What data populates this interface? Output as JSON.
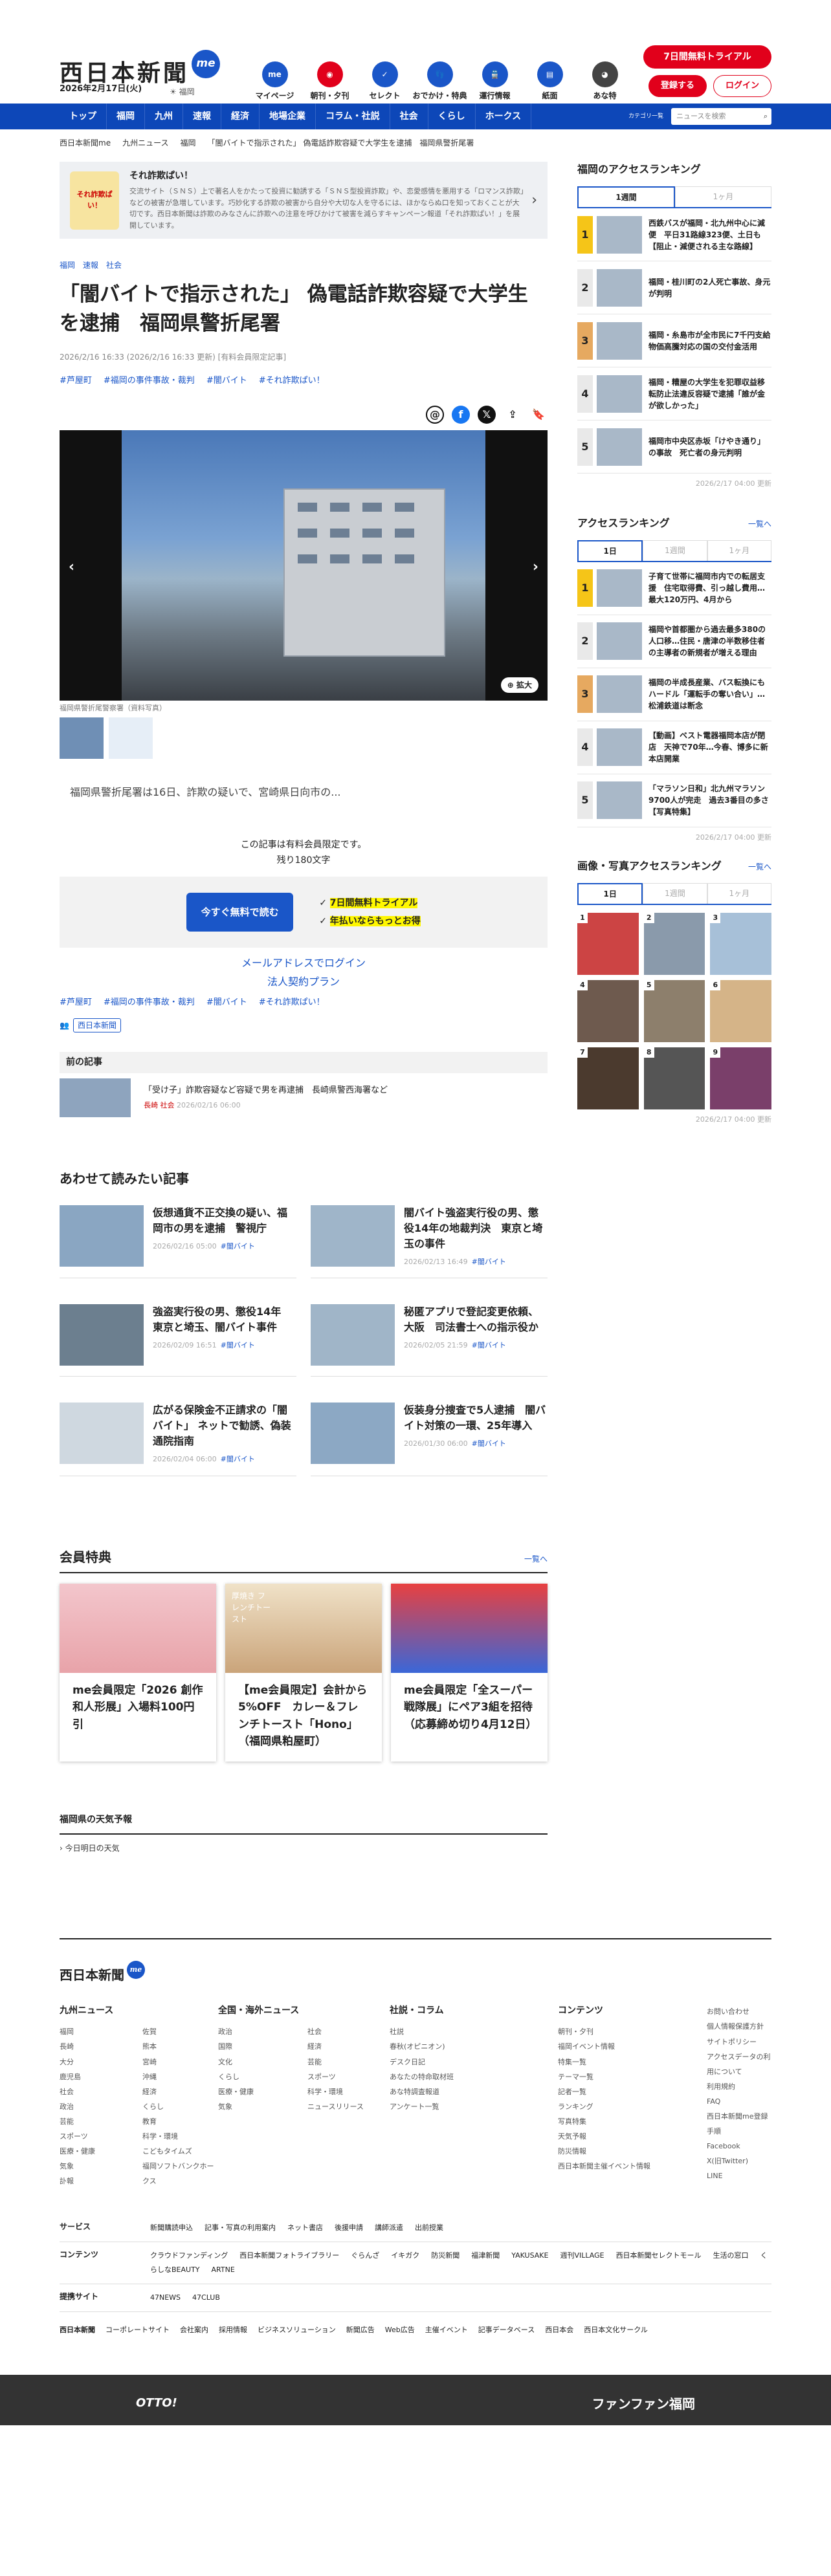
{
  "header": {
    "logo": "西日本新聞",
    "me": "me",
    "date": "2026年2月17日(火)",
    "weather": "福岡",
    "icons": [
      {
        "label": "マイページ",
        "icon": "me-icon",
        "color": "#1a56c8",
        "glyph": "me"
      },
      {
        "label": "朝刊・夕刊",
        "icon": "newspaper-icon",
        "color": "#e1001b",
        "glyph": "◉"
      },
      {
        "label": "セレクト",
        "icon": "select-icon",
        "color": "#1a56c8",
        "glyph": "✓"
      },
      {
        "label": "おでかけ・特典",
        "icon": "footsteps-icon",
        "color": "#1a56c8",
        "glyph": "👣"
      },
      {
        "label": "運行情報",
        "icon": "train-icon",
        "color": "#1a56c8",
        "glyph": "🚆"
      },
      {
        "label": "紙面",
        "icon": "paper-icon",
        "color": "#1a56c8",
        "glyph": "▤"
      },
      {
        "label": "あな特",
        "icon": "raccoon-icon",
        "color": "#444",
        "glyph": "◕"
      }
    ],
    "trial": "7日間無料トライアル",
    "register": "登録する",
    "login": "ログイン"
  },
  "nav": {
    "items": [
      "トップ",
      "福岡",
      "九州",
      "速報",
      "経済",
      "地場企業",
      "コラム・社説",
      "社会",
      "くらし",
      "ホークス"
    ],
    "category": "カテゴリ一覧",
    "search_placeholder": "ニュースを検索"
  },
  "breadcrumb": [
    "西日本新聞me",
    "九州ニュース",
    "福岡",
    "「闇バイトで指示された」 偽電話詐欺容疑で大学生を逮捕　福岡県警折尾署"
  ],
  "promo": {
    "img": "それ詐欺ぱい！",
    "title": "それ詐欺ぱい！",
    "text": "交流サイト（ＳＮＳ）上で著名人をかたって投資に勧誘する「ＳＮＳ型投資詐欺」や、恋愛感情を悪用する「ロマンス詐欺」などの被害が急増しています。巧妙化する詐欺の被害から自分や大切な人を守るには、ほかならぬ口を知っておくことが大切です。西日本新聞は詐欺のみなさんに詐欺への注意を呼びかけて被害を減らすキャンペーン報道「それ詐欺ぱい！」を展開しています。"
  },
  "article": {
    "categories": [
      "福岡",
      "速報",
      "社会"
    ],
    "title": "「闇バイトで指示された」 偽電話詐欺容疑で大学生を逮捕　福岡県警折尾署",
    "dates": "2026/2/16 16:33 (2026/2/16 16:33 更新) [有料会員限定記事]",
    "tags": [
      "#芦屋町",
      "#福岡の事件事故・裁判",
      "#闇バイト",
      "#それ詐欺ぱい！"
    ],
    "caption": "福岡県警折尾警察署（資料写真）",
    "zoom": "拡大",
    "lead": "福岡県警折尾署は16日、詐欺の疑いで、宮崎県日向市の...",
    "paywall_1": "この記事は有料会員限定です。",
    "paywall_2": "残り180文字",
    "cta": "今すぐ無料で読む",
    "benefits": [
      "7日間無料トライアル",
      "年払いならもっとお得"
    ],
    "login_mail": "メールアドレスでログイン",
    "corp": "法人契約プラン",
    "author": "西日本新聞"
  },
  "prev": {
    "heading": "前の記事",
    "title": "「受け子」詐欺容疑など容疑で男を再逮捕　長崎県警西海署など",
    "meta": "長崎 社会",
    "date": "2026/02/16 06:00"
  },
  "related": {
    "heading": "あわせて読みたい記事",
    "items": [
      {
        "title": "仮想通貨不正交換の疑い、福岡市の男を逮捕　警視庁",
        "date": "2026/02/16 05:00",
        "tag": "#闇バイト"
      },
      {
        "title": "闇バイト強盗実行役の男、懲役14年の地裁判決　東京と埼玉の事件",
        "date": "2026/02/13 16:49",
        "tag": "#闇バイト"
      },
      {
        "title": "強盗実行役の男、懲役14年　東京と埼玉、闇バイト事件",
        "date": "2026/02/09 16:51",
        "tag": "#闇バイト"
      },
      {
        "title": "秘匿アプリで登記変更依頼、大阪　司法書士への指示役か",
        "date": "2026/02/05 21:59",
        "tag": "#闇バイト"
      },
      {
        "title": "広がる保険金不正請求の「闇バイト」 ネットで勧誘、偽装通院指南",
        "date": "2026/02/04 06:00",
        "tag": "#闇バイト"
      },
      {
        "title": "仮装身分捜査で5人逮捕　闇バイト対策の一環、25年導入",
        "date": "2026/01/30 06:00",
        "tag": "#闇バイト"
      }
    ]
  },
  "member": {
    "heading": "会員特典",
    "more": "一覧へ",
    "cards": [
      {
        "title": "me会員限定「2026 創作和人形展」入場料100円引"
      },
      {
        "title": "【me会員限定】会計から5%OFF　カレー＆フレンチトースト「Hono」（福岡県粕屋町）",
        "img": "厚焼き フレンチトースト"
      },
      {
        "title": "me会員限定「全スーパー戦隊展」にペア3組を招待（応募締め切り4月12日）"
      }
    ]
  },
  "weather": {
    "heading": "福岡県の天気予報",
    "item": "今日明日の天気"
  },
  "sidebar": {
    "rank1": {
      "heading": "福岡のアクセスランキング",
      "tabs": [
        "1週間",
        "1ヶ月"
      ],
      "items": [
        "西鉄バスが福岡・北九州中心に減便　平日31路線323便、土日も【阻止・減便される主な路線】",
        "福岡・桂川町の2人死亡事故、身元が判明",
        "福岡・糸島市が全市民に7千円支給　物価高騰対応の国の交付金活用",
        "福岡・糟屋の大学生を犯罪収益移転防止法違反容疑で逮捕「誰が金が欲しかった」",
        "福岡市中央区赤坂「けやき通り」の事故　死亡者の身元判明"
      ],
      "updated": "2026/2/17 04:00 更新"
    },
    "rank2": {
      "heading": "アクセスランキング",
      "more": "一覧へ",
      "tabs": [
        "1日",
        "1週間",
        "1ヶ月"
      ],
      "items": [
        "子育て世帯に福岡市内での転居支援　住宅取得費、引っ越し費用…最大120万円、4月から",
        "福岡や首都圏から過去最多380の人口移…住民・唐津の半数移住者の主導者の新規者が増える理由",
        "福岡の半成長産業、バス転換にもハードル「運転手の奪い合い」…松浦鉄道は断念",
        "【動画】ベスト電器福岡本店が閉店　天神で70年…今春、博多に新本店開業",
        "「マラソン日和」北九州マラソン9700人が完走　過去3番目の多さ【写真特集】"
      ],
      "updated": "2026/2/17 04:00 更新"
    },
    "photo": {
      "heading": "画像・写真アクセスランキング",
      "more": "一覧へ",
      "tabs": [
        "1日",
        "1週間",
        "1ヶ月"
      ],
      "nums": [
        "1",
        "2",
        "3",
        "4",
        "5",
        "6",
        "7",
        "8",
        "9"
      ],
      "updated": "2026/2/17 04:00 更新"
    }
  },
  "footer": {
    "logo": "西日本新聞",
    "cols": [
      {
        "h": "九州ニュース",
        "items": [
          "福岡",
          "長崎",
          "大分",
          "鹿児島",
          "社会",
          "政治",
          "芸能",
          "スポーツ",
          "医療・健康",
          "気象",
          "訃報",
          "佐賀",
          "熊本",
          "宮崎",
          "沖縄",
          "経済",
          "くらし",
          "教育",
          "科学・環境",
          "こどもタイムズ",
          "福岡ソフトバンクホークス"
        ]
      },
      {
        "h": "全国・海外ニュース",
        "items": [
          "政治",
          "国際",
          "文化",
          "くらし",
          "医療・健康",
          "気象",
          "社会",
          "経済",
          "芸能",
          "スポーツ",
          "科学・環境",
          "ニュースリリース"
        ]
      },
      {
        "h": "社説・コラム",
        "items": [
          "社説",
          "春秋(オピニオン)",
          "デスク日記",
          "あなたの特命取材班",
          "あな特調査報道",
          "アンケート一覧"
        ]
      },
      {
        "h": "コンテンツ",
        "items": [
          "朝刊・夕刊",
          "福岡イベント情報",
          "特集一覧",
          "テーマ一覧",
          "記者一覧",
          "ランキング",
          "写真特集",
          "天気予報",
          "防災情報",
          "西日本新聞主催イベント情報"
        ]
      },
      {
        "h": "",
        "items": [
          "お問い合わせ",
          "個人情報保護方針",
          "サイトポリシー",
          "アクセスデータの利用について",
          "利用規約",
          "FAQ",
          "西日本新聞me登録手順",
          "Facebook",
          "X(旧Twitter)",
          "LINE"
        ]
      }
    ],
    "rows": [
      {
        "h": "サービス",
        "items": [
          "新聞購読申込",
          "記事・写真の利用案内",
          "ネット書店",
          "後援申請",
          "講師派遣",
          "出前授業"
        ]
      },
      {
        "h": "コンテンツ",
        "items": [
          "クラウドファンディング",
          "西日本新聞フォトライブラリー",
          "ぐらんざ",
          "イキガク",
          "防災新聞",
          "福津新聞",
          "YAKUSAKE",
          "週刊VILLAGE",
          "西日本新聞セレクトモール",
          "生活の窓口",
          "くらしなBEAUTY",
          "ARTNE"
        ]
      },
      {
        "h": "提携サイト",
        "items": [
          "47NEWS",
          "47CLUB"
        ]
      }
    ],
    "bottom": [
      "西日本新聞",
      "コーポレートサイト",
      "会社案内",
      "採用情報",
      "ビジネスソリューション",
      "新聞広告",
      "Web広告",
      "主催イベント",
      "記事データベース",
      "西日本会",
      "西日本文化サークル"
    ],
    "bar_left": "OTTO!",
    "bar_right": "ファンファン福岡"
  }
}
